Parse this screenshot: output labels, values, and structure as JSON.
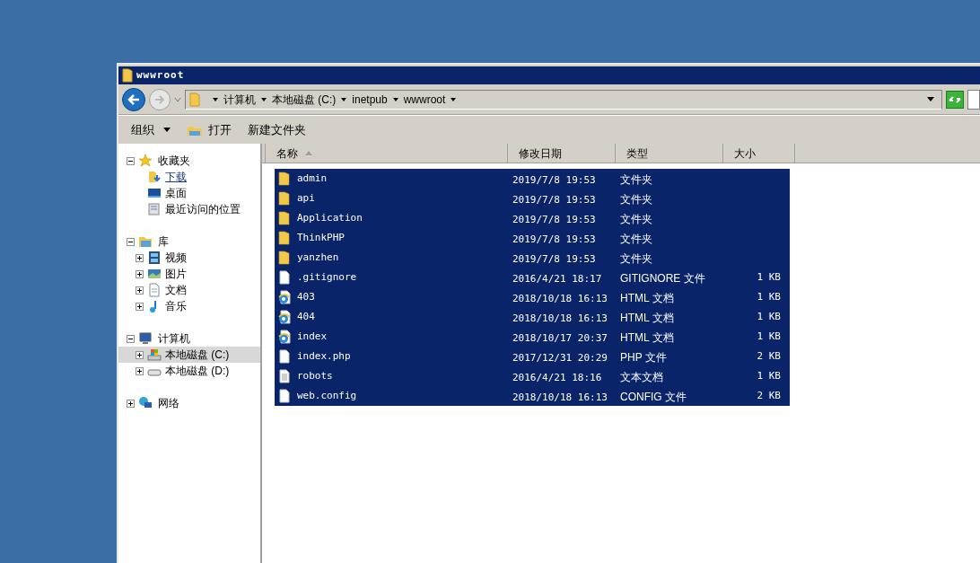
{
  "window": {
    "title": "wwwroot"
  },
  "address": {
    "breadcrumbs": [
      "计算机",
      "本地磁盘 (C:)",
      "inetpub",
      "wwwroot"
    ]
  },
  "toolbar": [
    {
      "label": "组织",
      "kind": "menu"
    },
    {
      "label": "打开",
      "kind": "open"
    },
    {
      "label": "新建文件夹",
      "kind": "plain"
    }
  ],
  "nav": [
    {
      "label": "收藏夹",
      "kind": "star",
      "expanded": true,
      "selected": false,
      "children": [
        {
          "label": "下载",
          "kind": "download",
          "hovered": true,
          "selected": false
        },
        {
          "label": "桌面",
          "kind": "desktop",
          "hovered": false,
          "selected": false
        },
        {
          "label": "最近访问的位置",
          "kind": "recent",
          "hovered": false,
          "selected": false
        }
      ]
    },
    {
      "label": "库",
      "kind": "library",
      "expanded": true,
      "selected": false,
      "children": [
        {
          "label": "视频",
          "kind": "video",
          "expanded": false,
          "selected": false
        },
        {
          "label": "图片",
          "kind": "picture",
          "expanded": false,
          "selected": false
        },
        {
          "label": "文档",
          "kind": "document",
          "expanded": false,
          "selected": false
        },
        {
          "label": "音乐",
          "kind": "music",
          "expanded": false,
          "selected": false
        }
      ]
    },
    {
      "label": "计算机",
      "kind": "computer",
      "expanded": true,
      "selected": false,
      "children": [
        {
          "label": "本地磁盘 (C:)",
          "kind": "sysdrive",
          "expanded": false,
          "selected": true
        },
        {
          "label": "本地磁盘 (D:)",
          "kind": "drive",
          "expanded": false,
          "selected": false
        }
      ]
    },
    {
      "label": "网络",
      "kind": "network",
      "expanded": false,
      "selected": false
    }
  ],
  "table": {
    "columns": [
      {
        "label": "名称",
        "sorted": true
      },
      {
        "label": "修改日期",
        "sorted": false
      },
      {
        "label": "类型",
        "sorted": false
      },
      {
        "label": "大小",
        "sorted": false
      }
    ],
    "rows": [
      {
        "kind": "folder",
        "name": "admin",
        "date": "2019/7/8 19:53",
        "type": "文件夹",
        "selected": true
      },
      {
        "kind": "folder",
        "name": "api",
        "date": "2019/7/8 19:53",
        "type": "文件夹",
        "selected": true
      },
      {
        "kind": "folder",
        "name": "Application",
        "date": "2019/7/8 19:53",
        "type": "文件夹",
        "selected": true
      },
      {
        "kind": "folder",
        "name": "ThinkPHP",
        "date": "2019/7/8 19:53",
        "type": "文件夹",
        "selected": true
      },
      {
        "kind": "folder",
        "name": "yanzhen",
        "date": "2019/7/8 19:53",
        "type": "文件夹",
        "selected": true
      },
      {
        "kind": "file",
        "name": ".gitignore",
        "date": "2016/4/21 18:17",
        "type": "GITIGNORE 文件",
        "size": "1 KB",
        "selected": true
      },
      {
        "kind": "html",
        "name": "403",
        "date": "2018/10/18 16:13",
        "type": "HTML 文档",
        "size": "1 KB",
        "selected": true
      },
      {
        "kind": "html",
        "name": "404",
        "date": "2018/10/18 16:13",
        "type": "HTML 文档",
        "size": "1 KB",
        "selected": true
      },
      {
        "kind": "html",
        "name": "index",
        "date": "2018/10/17 20:37",
        "type": "HTML 文档",
        "size": "1 KB",
        "selected": true
      },
      {
        "kind": "file",
        "name": "index.php",
        "date": "2017/12/31 20:29",
        "type": "PHP 文件",
        "size": "2 KB",
        "selected": true
      },
      {
        "kind": "text",
        "name": "robots",
        "date": "2016/4/21 18:16",
        "type": "文本文档",
        "size": "1 KB",
        "selected": true
      },
      {
        "kind": "file",
        "name": "web.config",
        "date": "2018/10/18 16:13",
        "type": "CONFIG 文件",
        "size": "2 KB",
        "selected": true
      }
    ]
  }
}
